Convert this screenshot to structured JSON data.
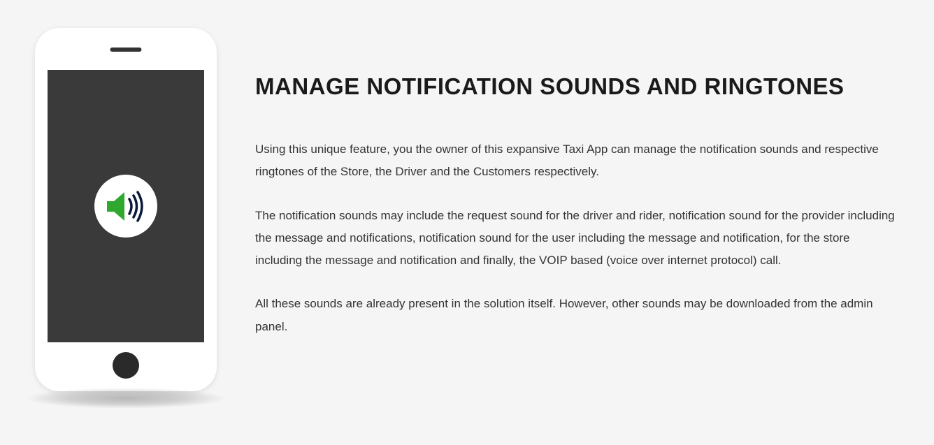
{
  "content": {
    "heading": "MANAGE NOTIFICATION SOUNDS AND RINGTONES",
    "paragraph1": "Using this unique feature, you the owner of this expansive Taxi App can manage the notification sounds and respective ringtones of the Store, the Driver and the Customers respectively.",
    "paragraph2": "The notification sounds may include the request sound for the driver and rider, notification sound for the provider including the message and notifications, notification sound for the user including the message and notification, for the store including the message and notification and finally, the VOIP based (voice over internet protocol) call.",
    "paragraph3": "All these sounds are already present in the solution itself. However, other sounds may be downloaded from the admin panel."
  }
}
